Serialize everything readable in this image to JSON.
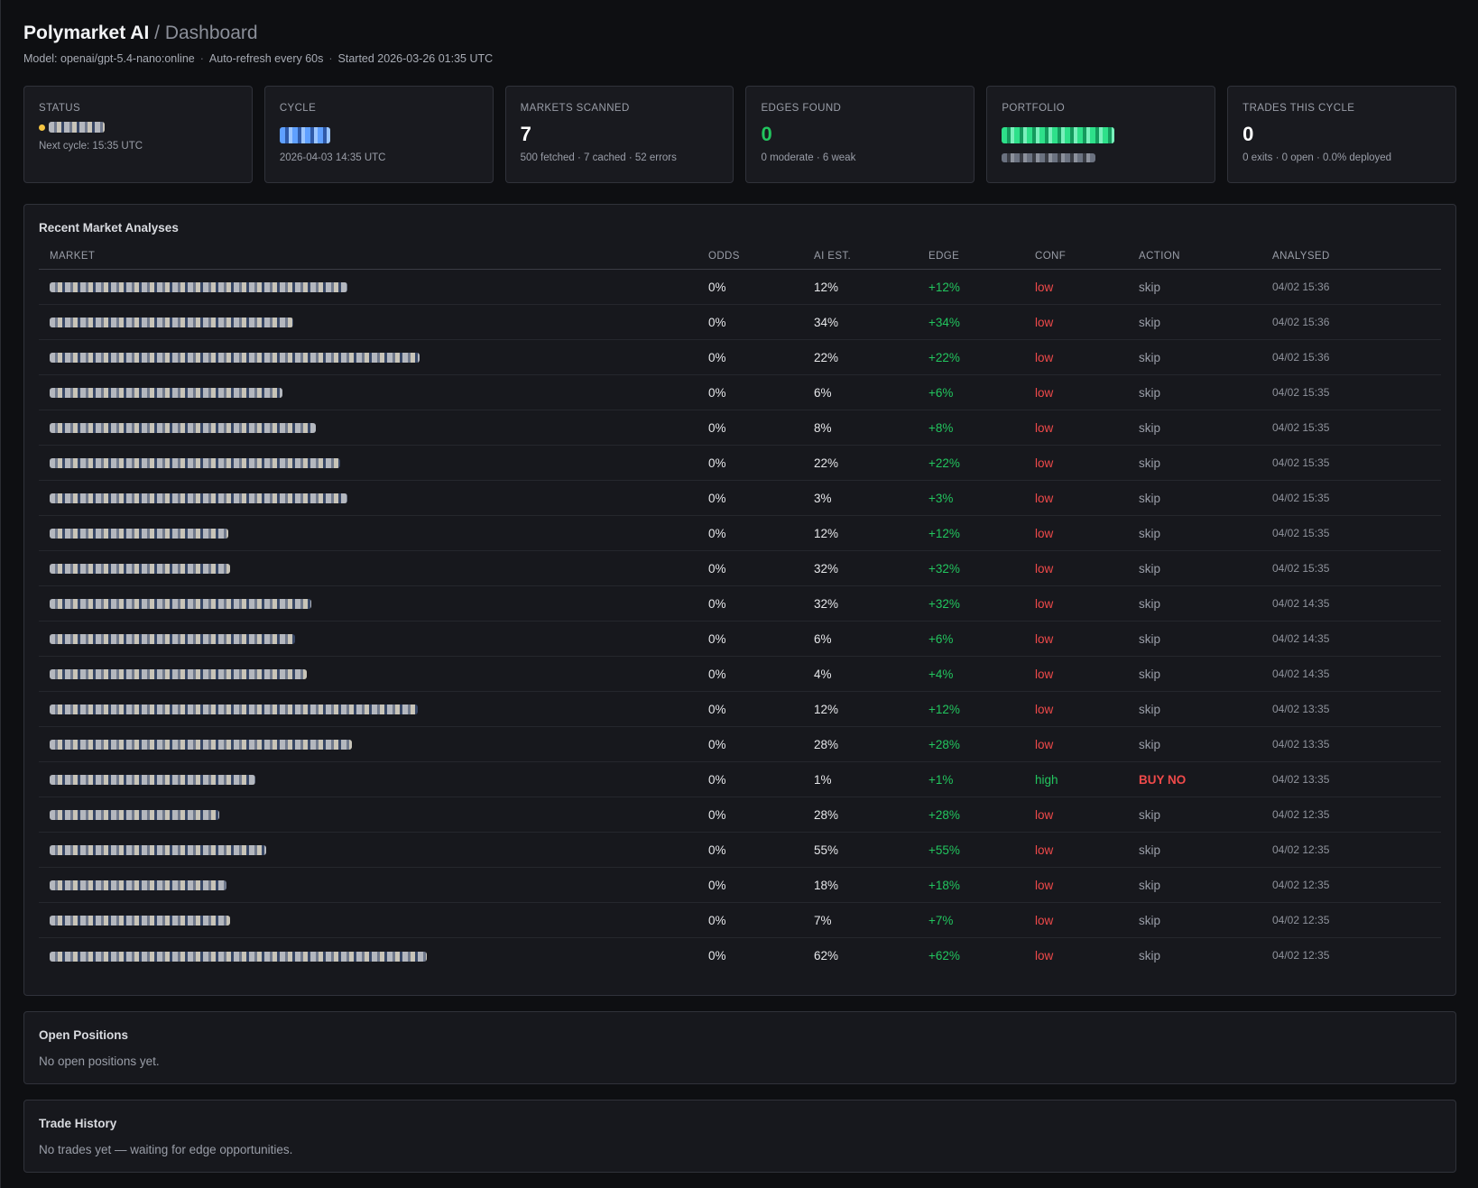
{
  "header": {
    "title": "Polymarket AI",
    "separator": "/",
    "subtitle": "Dashboard",
    "model": "Model: openai/gpt-5.4-nano:online",
    "refresh": "Auto-refresh every 60s",
    "started": "Started 2026-03-26 01:35 UTC"
  },
  "cards": {
    "status": {
      "label": "STATUS",
      "sub": "Next cycle: 15:35 UTC"
    },
    "cycle": {
      "label": "CYCLE",
      "sub": "2026-04-03 14:35 UTC"
    },
    "markets": {
      "label": "MARKETS SCANNED",
      "value": "7",
      "sub": "500 fetched · 7 cached · 52 errors"
    },
    "edges": {
      "label": "EDGES FOUND",
      "value": "0",
      "sub": "0 moderate · 6 weak"
    },
    "portfolio": {
      "label": "PORTFOLIO"
    },
    "trades": {
      "label": "TRADES THIS CYCLE",
      "value": "0",
      "sub": "0 exits · 0 open · 0.0% deployed"
    }
  },
  "analyses": {
    "title": "Recent Market Analyses",
    "columns": [
      "MARKET",
      "ODDS",
      "AI EST.",
      "EDGE",
      "CONF",
      "ACTION",
      "ANALYSED"
    ],
    "rows": [
      {
        "odds": "0%",
        "ai": "12%",
        "edge": "+12%",
        "conf": "low",
        "action": "skip",
        "time": "04/02 15:36"
      },
      {
        "odds": "0%",
        "ai": "34%",
        "edge": "+34%",
        "conf": "low",
        "action": "skip",
        "time": "04/02 15:36"
      },
      {
        "odds": "0%",
        "ai": "22%",
        "edge": "+22%",
        "conf": "low",
        "action": "skip",
        "time": "04/02 15:36"
      },
      {
        "odds": "0%",
        "ai": "6%",
        "edge": "+6%",
        "conf": "low",
        "action": "skip",
        "time": "04/02 15:35"
      },
      {
        "odds": "0%",
        "ai": "8%",
        "edge": "+8%",
        "conf": "low",
        "action": "skip",
        "time": "04/02 15:35"
      },
      {
        "odds": "0%",
        "ai": "22%",
        "edge": "+22%",
        "conf": "low",
        "action": "skip",
        "time": "04/02 15:35"
      },
      {
        "odds": "0%",
        "ai": "3%",
        "edge": "+3%",
        "conf": "low",
        "action": "skip",
        "time": "04/02 15:35"
      },
      {
        "odds": "0%",
        "ai": "12%",
        "edge": "+12%",
        "conf": "low",
        "action": "skip",
        "time": "04/02 15:35"
      },
      {
        "odds": "0%",
        "ai": "32%",
        "edge": "+32%",
        "conf": "low",
        "action": "skip",
        "time": "04/02 15:35"
      },
      {
        "odds": "0%",
        "ai": "32%",
        "edge": "+32%",
        "conf": "low",
        "action": "skip",
        "time": "04/02 14:35"
      },
      {
        "odds": "0%",
        "ai": "6%",
        "edge": "+6%",
        "conf": "low",
        "action": "skip",
        "time": "04/02 14:35"
      },
      {
        "odds": "0%",
        "ai": "4%",
        "edge": "+4%",
        "conf": "low",
        "action": "skip",
        "time": "04/02 14:35"
      },
      {
        "odds": "0%",
        "ai": "12%",
        "edge": "+12%",
        "conf": "low",
        "action": "skip",
        "time": "04/02 13:35"
      },
      {
        "odds": "0%",
        "ai": "28%",
        "edge": "+28%",
        "conf": "low",
        "action": "skip",
        "time": "04/02 13:35"
      },
      {
        "odds": "0%",
        "ai": "1%",
        "edge": "+1%",
        "conf": "high",
        "action": "BUY NO",
        "time": "04/02 13:35"
      },
      {
        "odds": "0%",
        "ai": "28%",
        "edge": "+28%",
        "conf": "low",
        "action": "skip",
        "time": "04/02 12:35"
      },
      {
        "odds": "0%",
        "ai": "55%",
        "edge": "+55%",
        "conf": "low",
        "action": "skip",
        "time": "04/02 12:35"
      },
      {
        "odds": "0%",
        "ai": "18%",
        "edge": "+18%",
        "conf": "low",
        "action": "skip",
        "time": "04/02 12:35"
      },
      {
        "odds": "0%",
        "ai": "7%",
        "edge": "+7%",
        "conf": "low",
        "action": "skip",
        "time": "04/02 12:35"
      },
      {
        "odds": "0%",
        "ai": "62%",
        "edge": "+62%",
        "conf": "low",
        "action": "skip",
        "time": "04/02 12:35"
      }
    ]
  },
  "positions": {
    "title": "Open Positions",
    "empty": "No open positions yet."
  },
  "history": {
    "title": "Trade History",
    "empty": "No trades yet — waiting for edge opportunities."
  },
  "colors": {
    "positive": "#22c55e",
    "negative": "#f04a4a",
    "background": "#0e0f12",
    "panel": "#17181d"
  }
}
